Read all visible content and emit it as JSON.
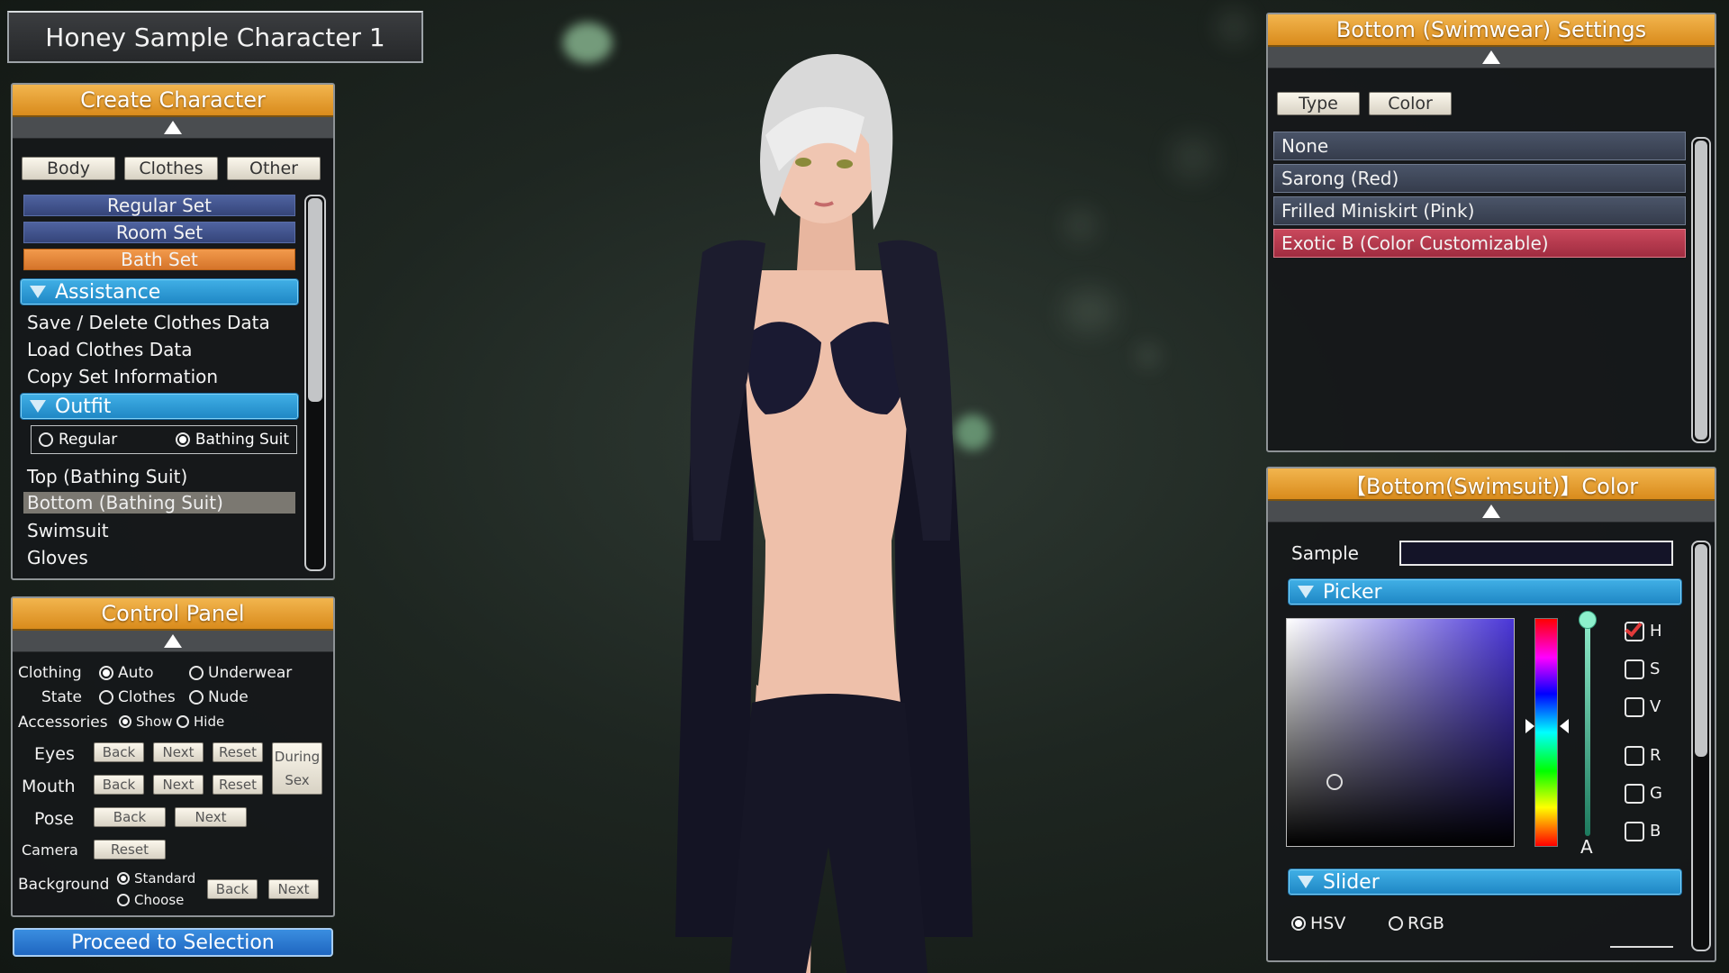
{
  "title": "Honey Sample Character 1",
  "create_panel": {
    "header": "Create Character",
    "tabs": [
      "Body",
      "Clothes",
      "Other"
    ],
    "sets": [
      "Regular Set",
      "Room Set",
      "Bath Set"
    ],
    "assistance_header": "Assistance",
    "assistance_items": [
      "Save / Delete Clothes Data",
      "Load Clothes Data",
      "Copy Set Information"
    ],
    "outfit_header": "Outfit",
    "outfit_options": [
      "Regular",
      "Bathing Suit"
    ],
    "outfit_selected": "Bathing Suit",
    "outfit_items": [
      "Top (Bathing Suit)",
      "Bottom (Bathing Suit)",
      "Swimsuit",
      "Gloves"
    ],
    "outfit_selected_item": "Bottom (Bathing Suit)"
  },
  "control_panel": {
    "header": "Control Panel",
    "clothing_label": "Clothing",
    "state_label": "State",
    "clothing_options": [
      "Auto",
      "Underwear",
      "Clothes",
      "Nude"
    ],
    "clothing_selected": "Auto",
    "accessories_label": "Accessories",
    "accessories_options": [
      "Show",
      "Hide"
    ],
    "accessories_selected": "Show",
    "eyes_label": "Eyes",
    "mouth_label": "Mouth",
    "pose_label": "Pose",
    "camera_label": "Camera",
    "background_label": "Background",
    "background_options": [
      "Standard",
      "Choose"
    ],
    "background_selected": "Standard",
    "back": "Back",
    "next": "Next",
    "reset": "Reset",
    "during_sex_line1": "During",
    "during_sex_line2": "Sex"
  },
  "proceed_button": "Proceed to Selection",
  "bottom_settings": {
    "header": "Bottom (Swimwear) Settings",
    "tabs": [
      "Type",
      "Color"
    ],
    "items": [
      "None",
      "Sarong (Red)",
      "Frilled Miniskirt (Pink)",
      "Exotic B (Color Customizable)"
    ],
    "selected": "Exotic B (Color Customizable)"
  },
  "color_panel": {
    "header": "【Bottom(Swimsuit)】Color",
    "sample_label": "Sample",
    "picker_header": "Picker",
    "alpha_label": "A",
    "channels": [
      "H",
      "S",
      "V",
      "R",
      "G",
      "B"
    ],
    "channel_checked": "H",
    "slider_header": "Slider",
    "mode_options": [
      "HSV",
      "RGB"
    ],
    "mode_selected": "HSV",
    "hue_color": "#4a36d8",
    "sample_color": "#141428"
  },
  "colors": {
    "panel_header": "#e4a033",
    "section_blue": "#2f9ad8",
    "selected_red": "#b43a4e",
    "set_blue": "#3f5190"
  }
}
